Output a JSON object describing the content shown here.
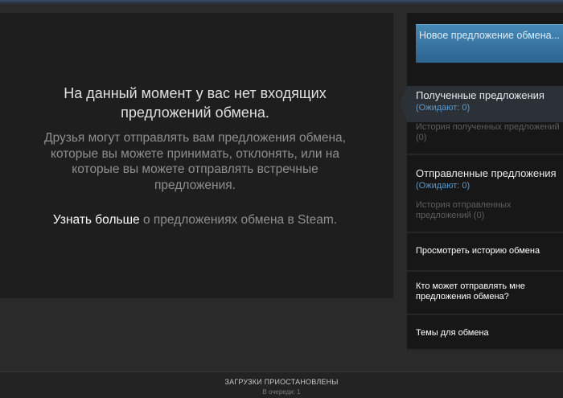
{
  "main": {
    "empty_title": "На данный момент у вас нет входящих предложений обмена.",
    "empty_body": "Друзья могут отправлять вам предложения обмена, которые вы можете принимать, отклонять, или на которые вы можете отправлять встречные предложения.",
    "learn_more_link": "Узнать больше",
    "learn_more_suffix": " о предложениях обмена в Steam."
  },
  "sidebar": {
    "new_offer_label": "Новое предложение обмена...",
    "received": {
      "title": "Полученные предложения",
      "pending": "(Ожидают: 0)",
      "history": "История полученных предложений (0)"
    },
    "sent": {
      "title": "Отправленные предложения",
      "pending": "(Ожидают: 0)",
      "history": "История отправленных предложений (0)"
    },
    "links": {
      "trade_history": "Просмотреть историю обмена",
      "who_can_send": "Кто может отправлять мне предложения обмена?",
      "trade_topics": "Темы для обмена"
    }
  },
  "footer": {
    "status": "ЗАГРУЗКИ ПРИОСТАНОВЛЕНЫ",
    "queue": "В очереди: 1"
  },
  "colors": {
    "accent": "#5a98cc",
    "button": "#3a77a6"
  }
}
